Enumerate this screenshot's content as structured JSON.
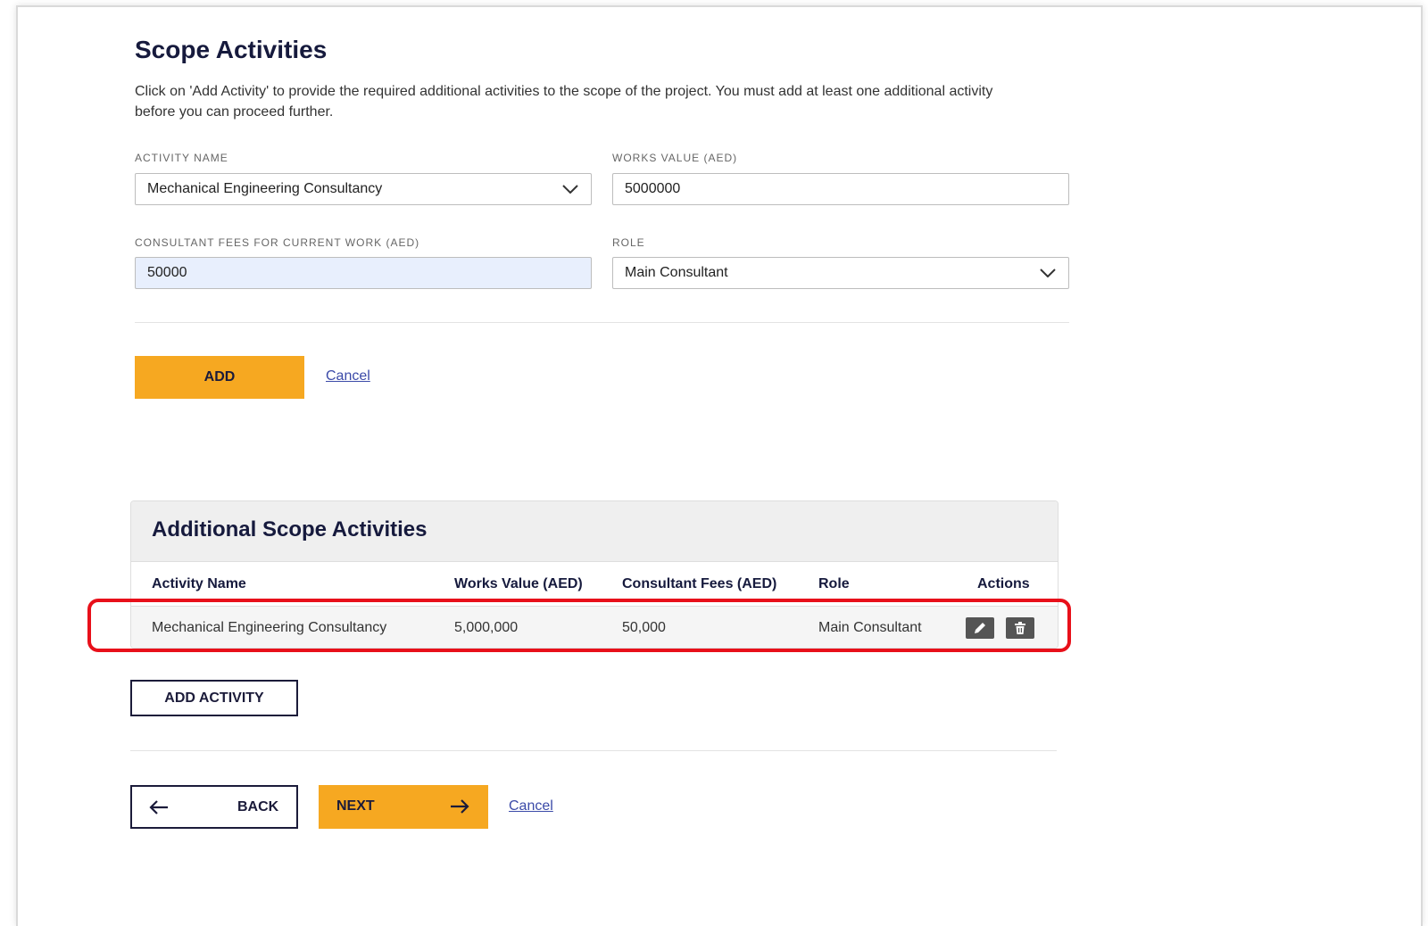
{
  "page": {
    "title": "Scope Activities",
    "intro": "Click on 'Add Activity' to provide the required additional activities to the scope of the project. You must add at least one additional activity before you can proceed further."
  },
  "form": {
    "activity_name": {
      "label": "ACTIVITY NAME",
      "value": "Mechanical Engineering Consultancy"
    },
    "works_value": {
      "label": "WORKS VALUE (AED)",
      "value": "5000000"
    },
    "consultant_fees": {
      "label": "CONSULTANT FEES FOR CURRENT WORK (AED)",
      "value": "50000"
    },
    "role": {
      "label": "ROLE",
      "value": "Main Consultant"
    },
    "add_button": "ADD",
    "cancel_link": "Cancel"
  },
  "table": {
    "title": "Additional Scope Activities",
    "headers": [
      "Activity Name",
      "Works Value (AED)",
      "Consultant Fees (AED)",
      "Role",
      "Actions"
    ],
    "rows": [
      {
        "activity": "Mechanical Engineering Consultancy",
        "works_value": "5,000,000",
        "fees": "50,000",
        "role": "Main Consultant"
      }
    ]
  },
  "add_activity_button": "ADD ACTIVITY",
  "nav": {
    "back": "BACK",
    "next": "NEXT",
    "cancel": "Cancel"
  },
  "icons": {
    "edit": "pencil-icon",
    "delete": "trash-icon",
    "dropdown": "chevron-down-icon",
    "back": "arrow-left-icon",
    "next": "arrow-right-icon"
  },
  "colors": {
    "accent": "#f6a821",
    "highlight": "#e8101a",
    "filled_field": "#e8effd"
  }
}
